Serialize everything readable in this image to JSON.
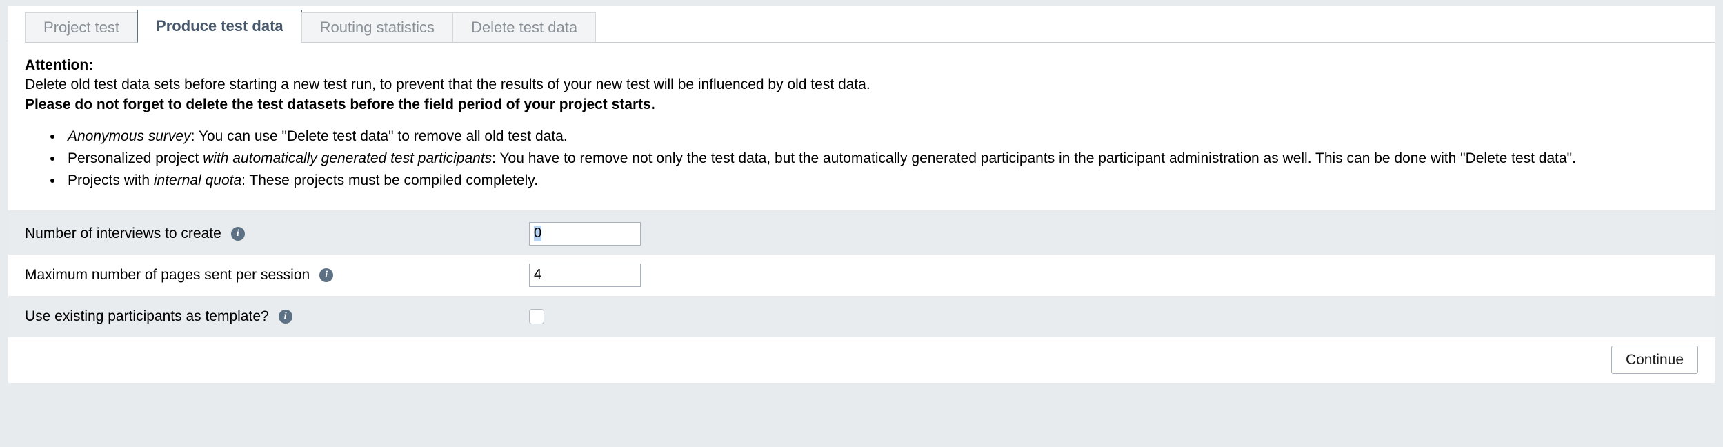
{
  "tabs": [
    {
      "label": "Project test",
      "active": false
    },
    {
      "label": "Produce test data",
      "active": true
    },
    {
      "label": "Routing statistics",
      "active": false
    },
    {
      "label": "Delete test data",
      "active": false
    }
  ],
  "attention": {
    "title": "Attention:",
    "line1": "Delete old test data sets before starting a new test run, to prevent that the results of your new test will be influenced by old test data.",
    "line2": "Please do not forget to delete the test datasets before the field period of your project starts.",
    "bullets": [
      {
        "parts": [
          {
            "text": "Anonymous survey",
            "italic": true
          },
          {
            "text": ": You can use \"Delete test data\" to remove all old test data.",
            "italic": false
          }
        ]
      },
      {
        "parts": [
          {
            "text": "Personalized project ",
            "italic": false
          },
          {
            "text": "with automatically generated test participants",
            "italic": true
          },
          {
            "text": ": You have to remove not only the test data, but the automatically generated participants in the participant administration as well. This can be done with \"Delete test data\".",
            "italic": false
          }
        ]
      },
      {
        "parts": [
          {
            "text": "Projects with ",
            "italic": false
          },
          {
            "text": "internal quota",
            "italic": true
          },
          {
            "text": ": These projects must be compiled completely.",
            "italic": false
          }
        ]
      }
    ]
  },
  "form": {
    "rows": [
      {
        "label": "Number of interviews to create",
        "info_icon": "info-icon",
        "control": "text",
        "value": "0",
        "placeholder": ""
      },
      {
        "label": "Maximum number of pages sent per session",
        "info_icon": "info-icon",
        "control": "text",
        "value": "4",
        "placeholder": ""
      },
      {
        "label": "Use existing participants as template?",
        "info_icon": "info-icon",
        "control": "checkbox",
        "checked": false
      }
    ]
  },
  "footer": {
    "continue_label": "Continue"
  },
  "colors": {
    "page_bg": "#e8ebee",
    "panel_bg": "#ffffff",
    "row_alt_bg": "#e8ecef",
    "active_tab_text": "#49596b",
    "inactive_tab_text": "#8a9096",
    "info_icon": "#5c7184",
    "selection": "#b9d3f3"
  }
}
